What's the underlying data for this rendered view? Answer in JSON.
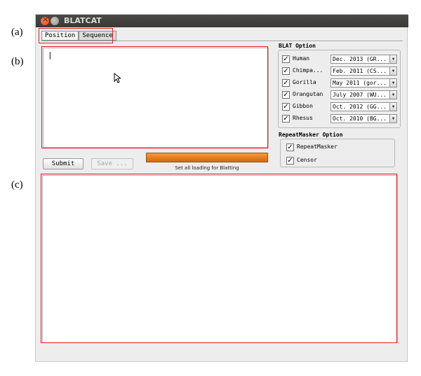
{
  "panel_labels": {
    "a": "(a)",
    "b": "(b)",
    "c": "(c)"
  },
  "window": {
    "title": "BLATCAT"
  },
  "tabs": [
    {
      "label": "Position",
      "active": false
    },
    {
      "label": "Sequence",
      "active": true
    }
  ],
  "sequence_input": {
    "value": "|"
  },
  "buttons": {
    "submit": "Submit",
    "save": "Save ..."
  },
  "progress": {
    "label": "Set all loading for Blatting",
    "fraction": 1.0,
    "color": "#e07b1e"
  },
  "blat_option": {
    "title": "BLAT Option",
    "species": [
      {
        "name": "Human",
        "checked": true,
        "assembly": "Dec. 2013 (GR..."
      },
      {
        "name": "Chimpa...",
        "checked": true,
        "assembly": "Feb. 2011 (CS..."
      },
      {
        "name": "Gorilla",
        "checked": true,
        "assembly": "May 2011 (gor..."
      },
      {
        "name": "Orangutan",
        "checked": true,
        "assembly": "July 2007 (WU..."
      },
      {
        "name": "Gibbon",
        "checked": true,
        "assembly": "Oct. 2012 (GG..."
      },
      {
        "name": "Rhesus",
        "checked": true,
        "assembly": "Oct. 2010 (BG..."
      }
    ]
  },
  "repeatmasker_option": {
    "title": "RepeatMasker Option",
    "items": [
      {
        "name": "RepeatMasker",
        "checked": true
      },
      {
        "name": "Censor",
        "checked": true
      }
    ]
  },
  "colors": {
    "highlight": "#e0202a",
    "progress": "#e07b1e",
    "titlebar": "#3c3b37"
  },
  "icons": {
    "checkbox": "check-icon",
    "combo": "dropdown-arrow-icon",
    "pointer": "mouse-pointer-icon"
  }
}
